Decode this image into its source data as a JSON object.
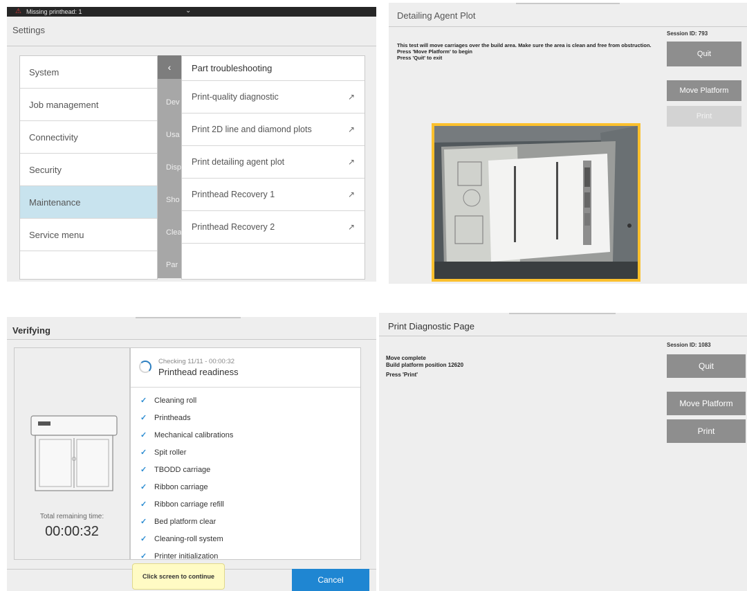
{
  "settings_panel": {
    "status_message": "Missing printhead: 1",
    "title": "Settings",
    "menu": [
      "System",
      "Job management",
      "Connectivity",
      "Security",
      "Maintenance",
      "Service menu"
    ],
    "selected": "Maintenance",
    "sub_stubs": [
      "Dev",
      "Usa",
      "Disp",
      "Sho",
      "Clea",
      "Par"
    ],
    "submenu_title": "Part troubleshooting",
    "submenu": [
      "Print-quality diagnostic",
      "Print 2D line and diamond plots",
      "Print detailing agent plot",
      "Printhead Recovery 1",
      "Printhead Recovery 2"
    ]
  },
  "detailing_panel": {
    "title": "Detailing Agent Plot",
    "instructions": [
      "This test will move carriages over the build area. Make sure the area is clean and free from obstruction.",
      "Press 'Move Platform' to begin",
      "Press 'Quit' to exit"
    ],
    "session": "Session ID: 793",
    "buttons": {
      "quit": "Quit",
      "move": "Move Platform",
      "print": "Print"
    }
  },
  "verifying_panel": {
    "title": "Verifying",
    "remaining_label": "Total remaining time:",
    "remaining_time": "00:00:32",
    "checking": "Checking 11/11 - 00:00:32",
    "current": "Printhead readiness",
    "items": [
      "Cleaning roll",
      "Printheads",
      "Mechanical calibrations",
      "Spit roller",
      "TBODD carriage",
      "Ribbon carriage",
      "Ribbon carriage refill",
      "Bed platform clear",
      "Cleaning-roll system",
      "Printer initialization"
    ],
    "toast": "Click screen to continue",
    "cancel": "Cancel"
  },
  "diagnostic_panel": {
    "title": "Print Diagnostic Page",
    "lines": [
      "Move complete",
      "Build platform position 12620",
      "Press 'Print'"
    ],
    "session": "Session ID: 1083",
    "buttons": {
      "quit": "Quit",
      "move": "Move Platform",
      "print": "Print"
    }
  }
}
